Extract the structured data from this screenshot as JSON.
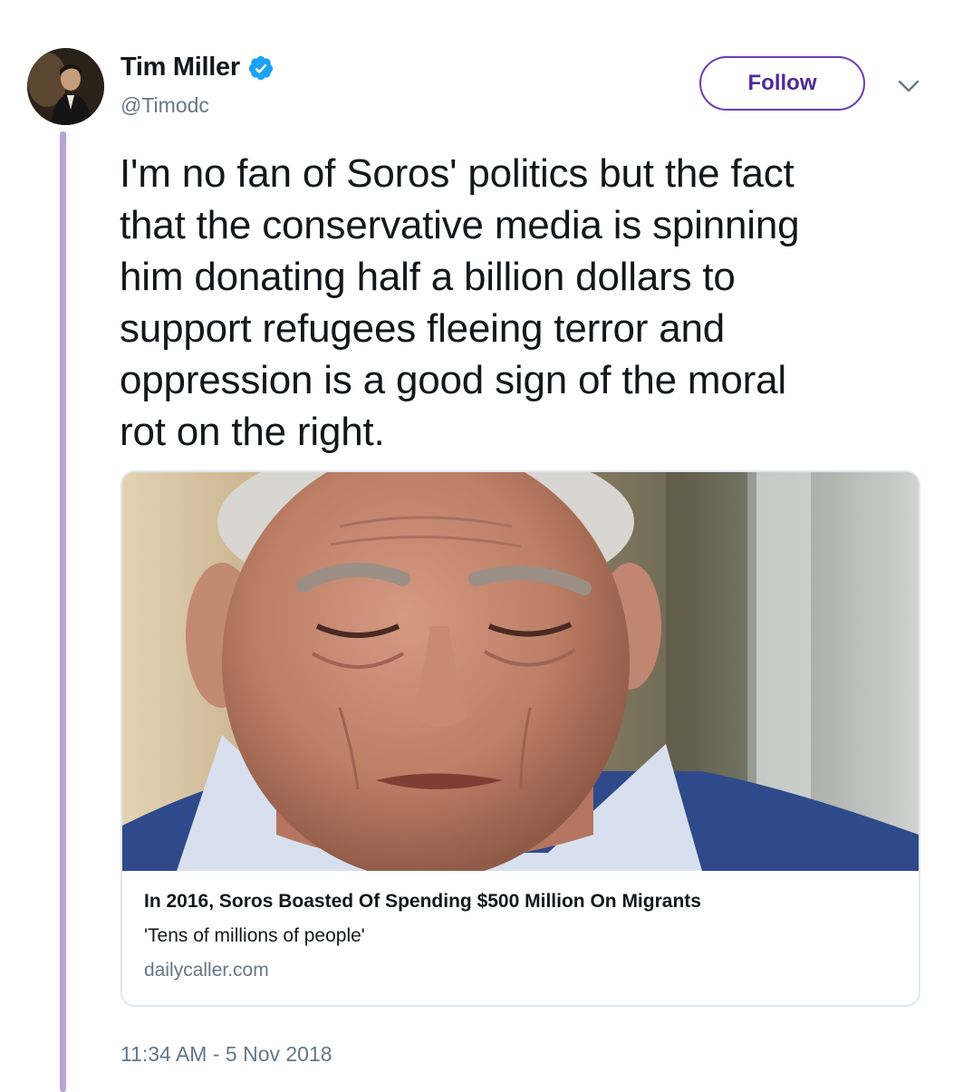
{
  "author": {
    "display_name": "Tim Miller",
    "handle": "@Timodc",
    "verified": true
  },
  "follow_button": {
    "label": "Follow"
  },
  "tweet": {
    "lines": [
      "I'm no fan of Soros' politics but the fact",
      "that the conservative media is spinning",
      "him donating half a billion dollars to",
      "support refugees fleeing terror and",
      "oppression is a good sign of the moral",
      "rot on the right."
    ],
    "timestamp": "11:34 AM - 5 Nov 2018"
  },
  "link_card": {
    "title": "In 2016, Soros Boasted Of Spending $500 Million On Migrants",
    "description": "'Tens of millions of people'",
    "domain": "dailycaller.com"
  },
  "colors": {
    "follow_accent": "#6a3db8",
    "thread_line": "#b9a3d9",
    "verified_badge": "#1da1f2",
    "secondary_text": "#657786",
    "card_border": "#e1e8ed"
  },
  "icons": {
    "verified": "verified-badge-icon",
    "chevron": "chevron-down-icon"
  }
}
